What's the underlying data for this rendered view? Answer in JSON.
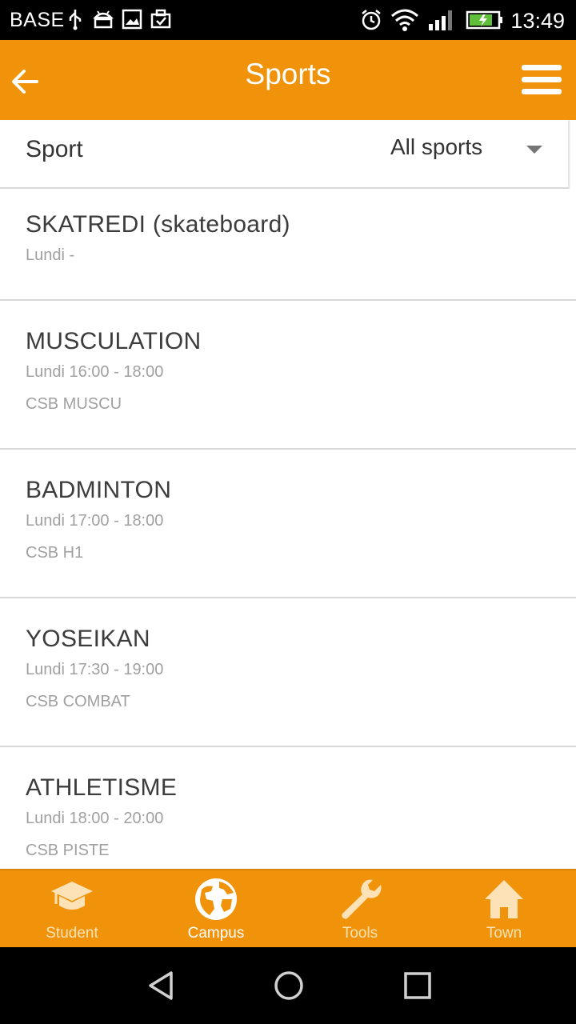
{
  "status_bar": {
    "carrier": "BASE",
    "time": "13:49",
    "icons": [
      "usb-icon",
      "android-icon",
      "image-icon",
      "briefcase-icon",
      "alarm-icon",
      "wifi-icon",
      "signal-icon",
      "battery-icon"
    ]
  },
  "app_bar": {
    "title": "Sports",
    "back_icon": "arrow-back-icon",
    "menu_icon": "hamburger-menu-icon"
  },
  "filter": {
    "label": "Sport",
    "selected": "All sports"
  },
  "sports": [
    {
      "name": "SKATREDI (skateboard)",
      "time": "Lundi -",
      "place": ""
    },
    {
      "name": "MUSCULATION",
      "time": "Lundi 16:00 - 18:00",
      "place": "CSB MUSCU"
    },
    {
      "name": "BADMINTON",
      "time": "Lundi 17:00 - 18:00",
      "place": "CSB H1"
    },
    {
      "name": "YOSEIKAN",
      "time": "Lundi 17:30 - 19:00",
      "place": "CSB COMBAT"
    },
    {
      "name": "ATHLETISME",
      "time": "Lundi 18:00 - 20:00",
      "place": "CSB PISTE"
    }
  ],
  "bottom_nav": {
    "tabs": [
      {
        "label": "Student",
        "icon": "graduation-cap-icon",
        "active": false
      },
      {
        "label": "Campus",
        "icon": "globe-icon",
        "active": true
      },
      {
        "label": "Tools",
        "icon": "wrench-icon",
        "active": false
      },
      {
        "label": "Town",
        "icon": "home-icon",
        "active": false
      }
    ]
  },
  "colors": {
    "accent": "#F0930A",
    "tab_inactive": "#FDE2B8",
    "tab_active": "#FFFFFF"
  }
}
